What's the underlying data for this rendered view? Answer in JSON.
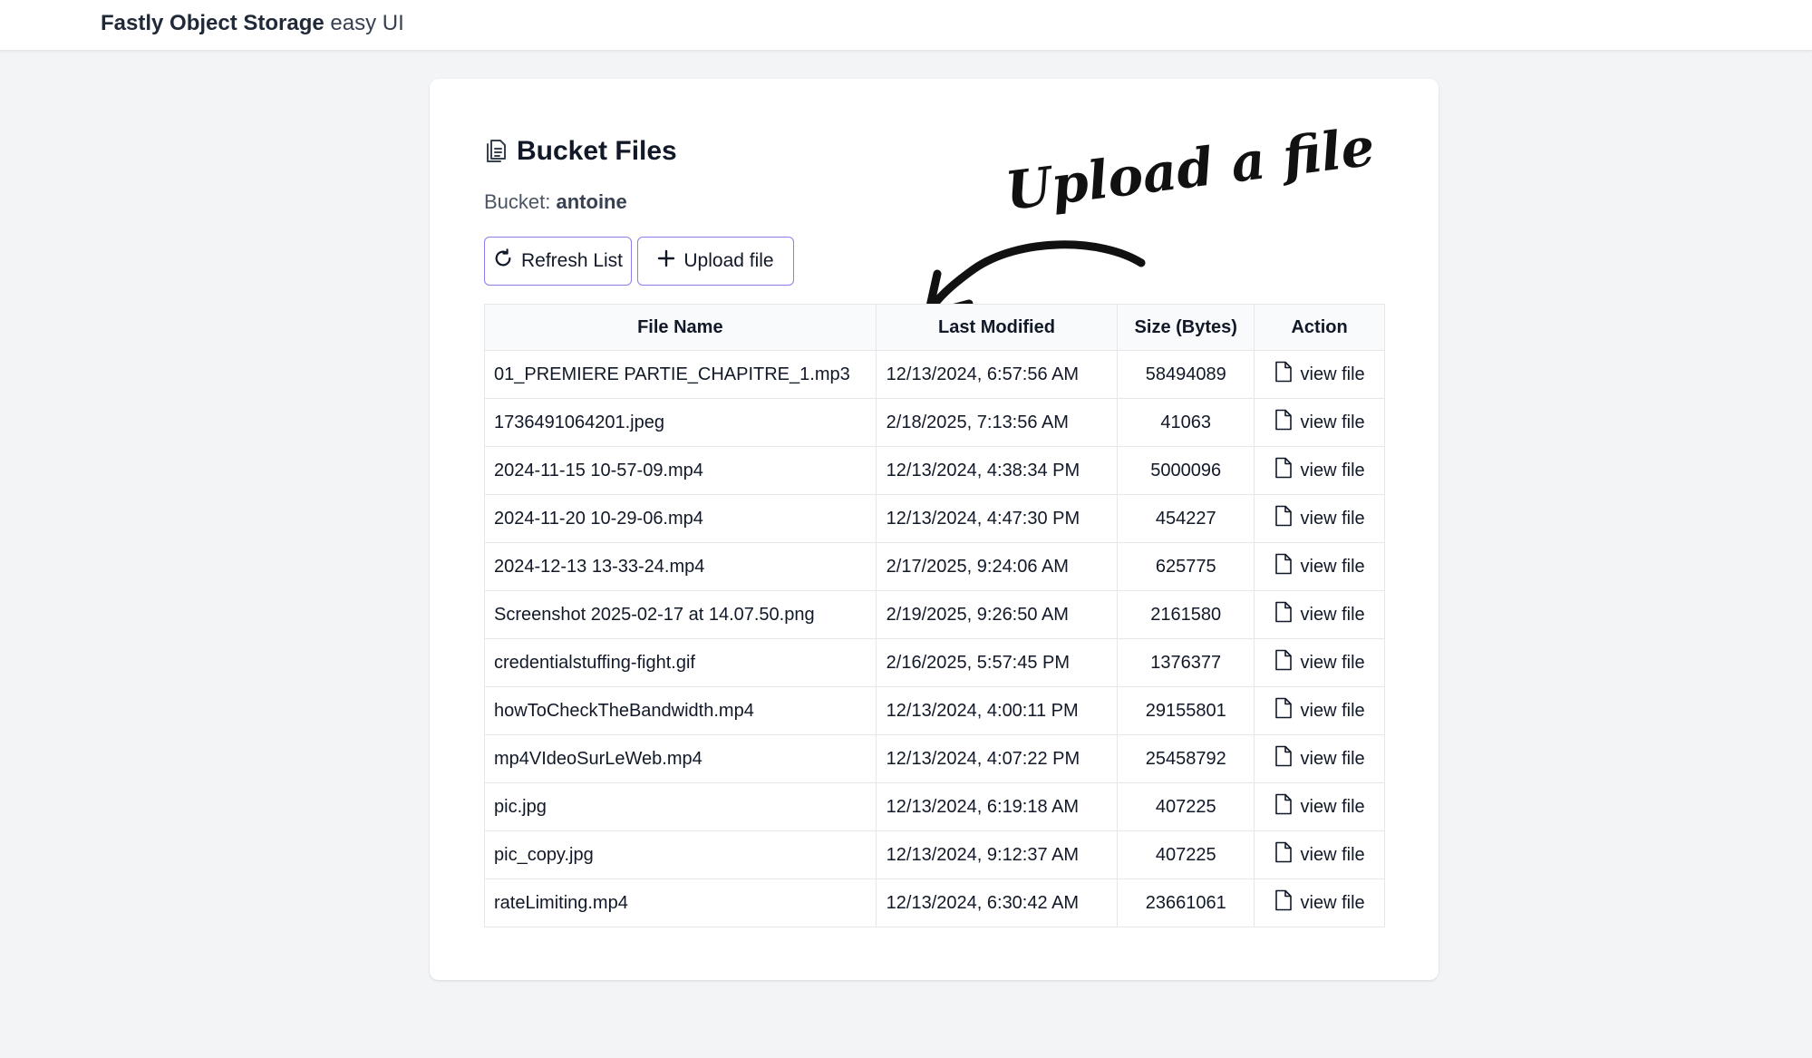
{
  "header": {
    "brand_strong": "Fastly Object Storage",
    "brand_light": "easy UI"
  },
  "page": {
    "title": "Bucket Files",
    "bucket_label": "Bucket:",
    "bucket_name": "antoine"
  },
  "toolbar": {
    "refresh_label": "Refresh List",
    "upload_label": "Upload file"
  },
  "annotation": {
    "text": "Upload a file"
  },
  "table": {
    "headers": [
      "File Name",
      "Last Modified",
      "Size (Bytes)",
      "Action"
    ],
    "action_label": "view file",
    "rows": [
      {
        "name": "01_PREMIERE PARTIE_CHAPITRE_1.mp3",
        "modified": "12/13/2024, 6:57:56 AM",
        "size": "58494089"
      },
      {
        "name": "1736491064201.jpeg",
        "modified": "2/18/2025, 7:13:56 AM",
        "size": "41063"
      },
      {
        "name": "2024-11-15 10-57-09.mp4",
        "modified": "12/13/2024, 4:38:34 PM",
        "size": "5000096"
      },
      {
        "name": "2024-11-20 10-29-06.mp4",
        "modified": "12/13/2024, 4:47:30 PM",
        "size": "454227"
      },
      {
        "name": "2024-12-13 13-33-24.mp4",
        "modified": "2/17/2025, 9:24:06 AM",
        "size": "625775"
      },
      {
        "name": "Screenshot 2025-02-17 at 14.07.50.png",
        "modified": "2/19/2025, 9:26:50 AM",
        "size": "2161580"
      },
      {
        "name": "credentialstuffing-fight.gif",
        "modified": "2/16/2025, 5:57:45 PM",
        "size": "1376377"
      },
      {
        "name": "howToCheckTheBandwidth.mp4",
        "modified": "12/13/2024, 4:00:11 PM",
        "size": "29155801"
      },
      {
        "name": "mp4VIdeoSurLeWeb.mp4",
        "modified": "12/13/2024, 4:07:22 PM",
        "size": "25458792"
      },
      {
        "name": "pic.jpg",
        "modified": "12/13/2024, 6:19:18 AM",
        "size": "407225"
      },
      {
        "name": "pic_copy.jpg",
        "modified": "12/13/2024, 9:12:37 AM",
        "size": "407225"
      },
      {
        "name": "rateLimiting.mp4",
        "modified": "12/13/2024, 6:30:42 AM",
        "size": "23661061"
      }
    ]
  },
  "colors": {
    "button_border": "#8b7cf0",
    "background": "#f3f4f6"
  }
}
